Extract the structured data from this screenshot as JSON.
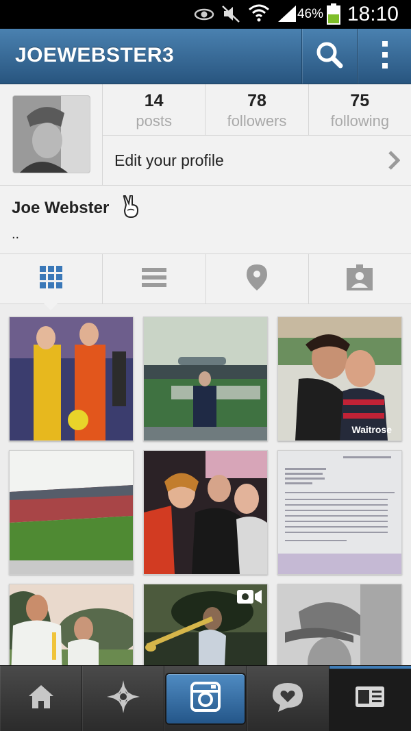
{
  "status_bar": {
    "battery_percent": "46%",
    "time": "18:10",
    "icons": [
      "eye-icon",
      "mute-icon",
      "wifi-icon",
      "signal-icon",
      "battery-icon"
    ]
  },
  "header": {
    "title": "JOEWEBSTER3",
    "icons": [
      "search-icon",
      "overflow-menu-icon"
    ]
  },
  "stats": [
    {
      "value": "14",
      "label": "posts"
    },
    {
      "value": "78",
      "label": "followers"
    },
    {
      "value": "75",
      "label": "following"
    }
  ],
  "edit_profile_label": "Edit your profile",
  "profile": {
    "name": "Joe Webster",
    "name_emoji": "peace-sign-icon",
    "bio": ".."
  },
  "view_tabs": [
    {
      "icon": "grid-icon",
      "active": true
    },
    {
      "icon": "list-icon",
      "active": false
    },
    {
      "icon": "location-pin-icon",
      "active": false
    },
    {
      "icon": "tagged-user-icon",
      "active": false
    }
  ],
  "photos": [
    {
      "watermark": ""
    },
    {
      "watermark": ""
    },
    {
      "watermark": "Waitrose"
    },
    {
      "watermark": ""
    },
    {
      "watermark": ""
    },
    {
      "watermark": ""
    },
    {
      "watermark": ""
    },
    {
      "watermark": ""
    },
    {
      "watermark": ""
    }
  ],
  "bottom_nav": [
    {
      "icon": "home-icon"
    },
    {
      "icon": "explore-star-icon"
    },
    {
      "icon": "camera-icon"
    },
    {
      "icon": "activity-heart-bubble-icon"
    },
    {
      "icon": "profile-card-icon",
      "active": true
    }
  ],
  "colors": {
    "header_blue": "#3a6d9a",
    "accent_blue": "#3f7cb6",
    "background": "#ededed",
    "nav_dark": "#2b2b2b"
  }
}
